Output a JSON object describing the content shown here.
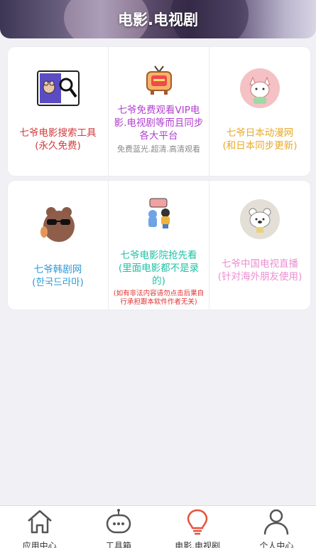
{
  "header": {
    "title": "电影.电视剧"
  },
  "cards": [
    {
      "items": [
        {
          "title": "七爷电影搜索工具\n(永久免费)",
          "color": "#d23a3a",
          "icon": "movie-search-icon"
        },
        {
          "title": "七爷免费观看VIP电影.电视剧等而且同步各大平台",
          "sub": "免费蓝光.超清.高清观看",
          "color": "#b13fcf",
          "icon": "tv-icon"
        },
        {
          "title": "七爷日本动漫网\n(和日本同步更新)",
          "color": "#e8a92a",
          "icon": "anime-cat-icon"
        }
      ]
    },
    {
      "items": [
        {
          "title": "七爷韩剧网\n(한국드라마)",
          "color": "#2d9ad8",
          "icon": "sunglasses-bear-icon"
        },
        {
          "title": "七爷电影院抢先看\n(里面电影都不是录的)",
          "note": "(如有非法内容请勿点击后果自行承担跟本软件作者无关)",
          "color": "#20c2a6",
          "icon": "cinema-kids-icon"
        },
        {
          "title": "七爷中国电视直播\n(针对海外朋友使用)",
          "color": "#ec8ed2",
          "icon": "white-bear-icon"
        }
      ]
    }
  ],
  "tabbar": [
    {
      "label": "应用中心",
      "icon": "home-icon",
      "active": false
    },
    {
      "label": "工具箱",
      "icon": "robot-icon",
      "active": false
    },
    {
      "label": "电影.电视剧",
      "icon": "lightbulb-icon",
      "active": true
    },
    {
      "label": "个人中心",
      "icon": "person-icon",
      "active": false
    }
  ],
  "colors": {
    "active_tab": "#e5533c",
    "inactive_tab": "#555555"
  }
}
